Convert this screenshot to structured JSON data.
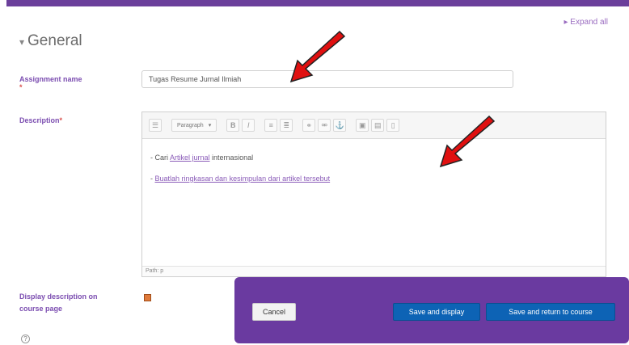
{
  "header": {
    "expand_all": "Expand all",
    "section_title": "General"
  },
  "form": {
    "assignment_name_label": "Assignment name",
    "assignment_name_value": "Tugas Resume Jurnal Ilmiah",
    "required_mark": "*",
    "description_label": "Description",
    "display_description_label": "Display description on course page"
  },
  "editor": {
    "toolbar": {
      "paragraph_select": "Paragraph",
      "bold": "B",
      "italic": "I"
    },
    "lines": [
      {
        "prefix": "- Cari ",
        "linked": "Artikel jurnal",
        "suffix": " internasional"
      },
      {
        "prefix": "- ",
        "linked": "Buatlah ringkasan dan kesimpulan dari artikel tersebut",
        "suffix": ""
      }
    ],
    "path": "Path: p"
  },
  "actions": {
    "cancel": "Cancel",
    "save_display": "Save and display",
    "save_return": "Save and return to course"
  },
  "colors": {
    "accent": "#6b3f9b",
    "primary_button": "#0d63b5",
    "arrow": "#e01010"
  }
}
